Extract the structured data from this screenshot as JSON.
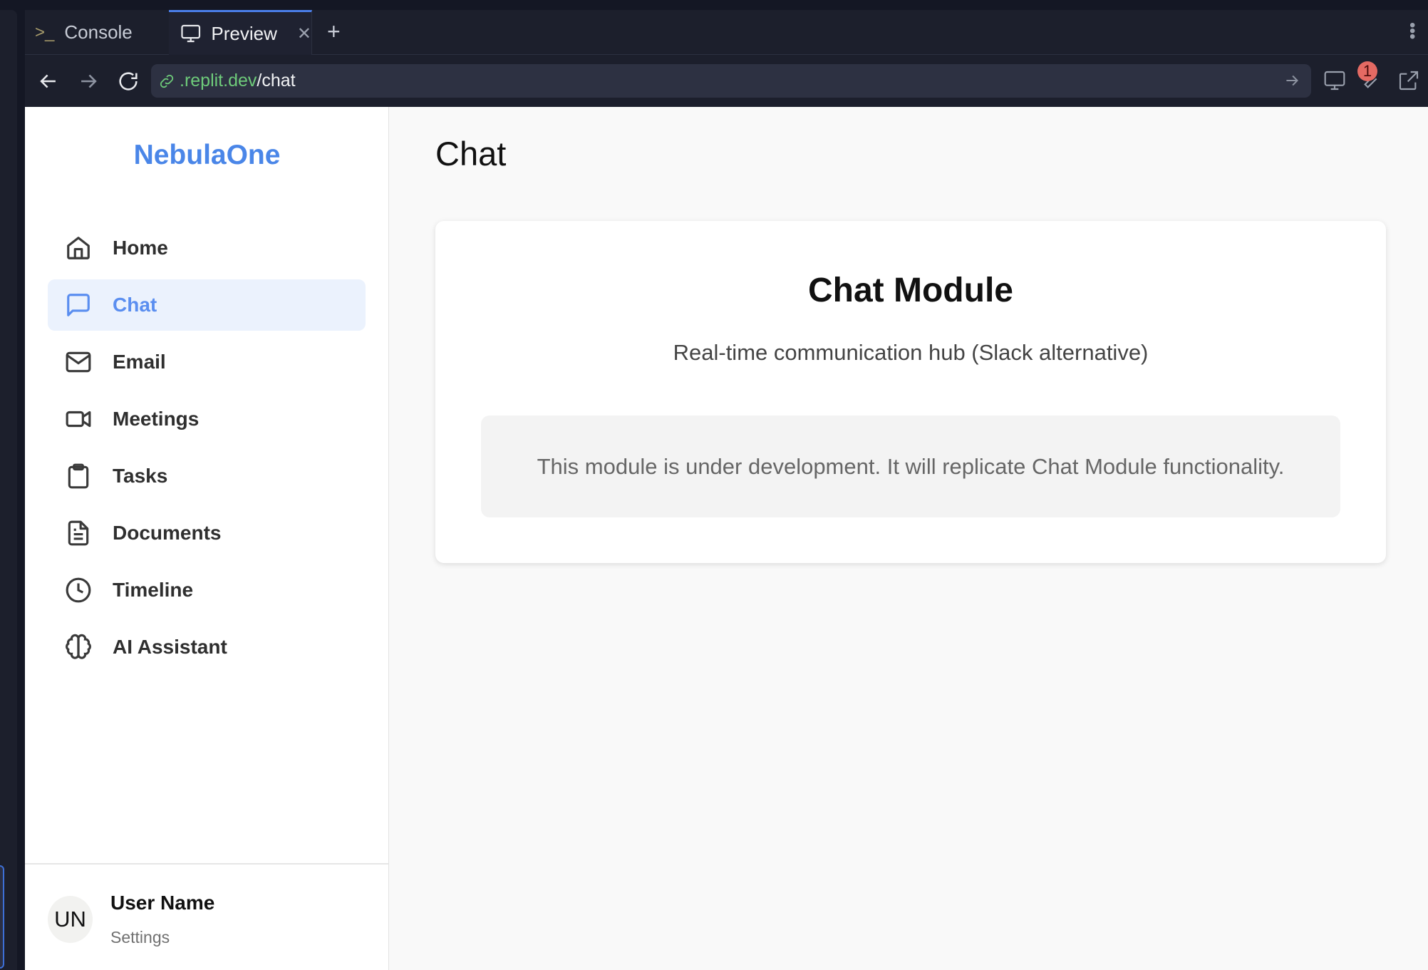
{
  "browser": {
    "tabs": [
      {
        "label": "Console",
        "icon": "terminal-icon"
      },
      {
        "label": "Preview",
        "icon": "monitor-icon",
        "active": true
      }
    ],
    "url": {
      "host": ".replit.dev",
      "path": "/chat"
    },
    "devtools_badge": "1",
    "accent": "#4a7ee8"
  },
  "sidebar": {
    "logo": "NebulaOne",
    "items": [
      {
        "label": "Home",
        "icon": "home-icon"
      },
      {
        "label": "Chat",
        "icon": "message-square-icon",
        "active": true
      },
      {
        "label": "Email",
        "icon": "mail-icon"
      },
      {
        "label": "Meetings",
        "icon": "video-icon"
      },
      {
        "label": "Tasks",
        "icon": "clipboard-icon"
      },
      {
        "label": "Documents",
        "icon": "file-text-icon"
      },
      {
        "label": "Timeline",
        "icon": "clock-icon"
      },
      {
        "label": "AI Assistant",
        "icon": "brain-icon"
      }
    ],
    "user": {
      "initials": "UN",
      "name": "User Name",
      "settings": "Settings"
    },
    "brand_color": "#4a86e8"
  },
  "main": {
    "title": "Chat",
    "card": {
      "title": "Chat Module",
      "subtitle": "Real-time communication hub (Slack alternative)",
      "notice": "This module is under development. It will replicate Chat Module functionality."
    }
  }
}
